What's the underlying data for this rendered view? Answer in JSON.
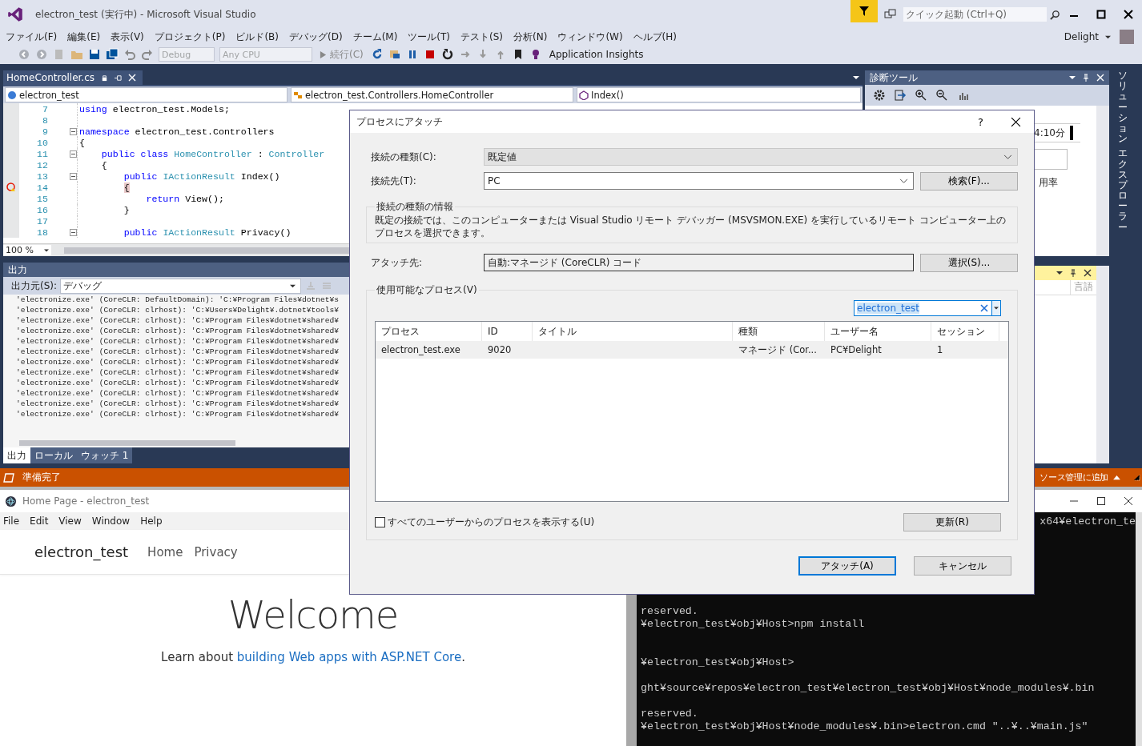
{
  "vs": {
    "title": "electron_test (実行中) - Microsoft Visual Studio",
    "quick_launch": {
      "placeholder": "クイック起動 (Ctrl+Q)"
    },
    "menu": [
      "ファイル(F)",
      "編集(E)",
      "表示(V)",
      "プロジェクト(P)",
      "ビルド(B)",
      "デバッグ(D)",
      "チーム(M)",
      "ツール(T)",
      "テスト(S)",
      "分析(N)",
      "ウィンドウ(W)",
      "ヘルプ(H)"
    ],
    "user": "Delight",
    "toolbar": {
      "configuration": {
        "label": "Debug",
        "disabled": true
      },
      "platform": {
        "label": "Any CPU",
        "disabled": true
      },
      "continue": "続行(C)",
      "insights": "Application Insights"
    },
    "editor": {
      "tab": "HomeController.cs",
      "project": "electron_test",
      "type": "electron_test.Controllers.HomeController",
      "member": "Index()",
      "zoom": "100 %",
      "lines": [
        {
          "number": "7",
          "fold": false,
          "breakpoint": false,
          "tokens": [
            {
              "kind": "keyword",
              "text": "using"
            },
            {
              "kind": "plain",
              "text": " electron_test.Models;"
            }
          ]
        },
        {
          "number": "8",
          "fold": false,
          "breakpoint": false
        },
        {
          "number": "9",
          "fold": true,
          "breakpoint": false,
          "tokens": [
            {
              "kind": "keyword",
              "text": "namespace"
            },
            {
              "kind": "plain",
              "text": " electron_test.Controllers"
            }
          ]
        },
        {
          "number": "10",
          "fold": false,
          "breakpoint": false,
          "tokens": [
            {
              "kind": "plain",
              "text": "{"
            }
          ]
        },
        {
          "number": "11",
          "fold": true,
          "breakpoint": false,
          "tokens": [
            {
              "kind": "keyword",
              "text": "    public class"
            },
            {
              "kind": "type",
              "text": " HomeController"
            },
            {
              "kind": "plain",
              "text": " : "
            },
            {
              "kind": "type",
              "text": "Controller"
            }
          ]
        },
        {
          "number": "12",
          "fold": false,
          "breakpoint": false,
          "tokens": [
            {
              "kind": "plain",
              "text": "    {"
            }
          ]
        },
        {
          "number": "13",
          "fold": true,
          "breakpoint": false,
          "tokens": [
            {
              "kind": "keyword",
              "text": "        public"
            },
            {
              "kind": "type",
              "text": " IActionResult"
            },
            {
              "kind": "plain",
              "text": " Index()"
            }
          ]
        },
        {
          "number": "14",
          "fold": false,
          "breakpoint": true,
          "tokens": [
            {
              "kind": "match",
              "text": "        {"
            }
          ]
        },
        {
          "number": "15",
          "fold": false,
          "breakpoint": false,
          "tokens": [
            {
              "kind": "keyword",
              "text": "            return"
            },
            {
              "kind": "plain",
              "text": " View();"
            }
          ]
        },
        {
          "number": "16",
          "fold": false,
          "breakpoint": false,
          "tokens": [
            {
              "kind": "plain",
              "text": "        }"
            }
          ]
        },
        {
          "number": "17",
          "fold": false,
          "breakpoint": false
        },
        {
          "number": "18",
          "fold": true,
          "breakpoint": false,
          "tokens": [
            {
              "kind": "keyword",
              "text": "        public"
            },
            {
              "kind": "type",
              "text": " IActionResult"
            },
            {
              "kind": "plain",
              "text": " Privacy()"
            }
          ]
        }
      ]
    },
    "output": {
      "title": "出力",
      "source_label": "出力元(S):",
      "source": "デバッグ",
      "lines": [
        "'electronize.exe' (CoreCLR: DefaultDomain): 'C:¥Program Files¥dotnet¥s",
        "'electronize.exe' (CoreCLR: clrhost): 'C:¥Users¥Delight¥.dotnet¥tools¥",
        "'electronize.exe' (CoreCLR: clrhost): 'C:¥Program Files¥dotnet¥shared¥",
        "'electronize.exe' (CoreCLR: clrhost): 'C:¥Program Files¥dotnet¥shared¥",
        "'electronize.exe' (CoreCLR: clrhost): 'C:¥Program Files¥dotnet¥shared¥",
        "'electronize.exe' (CoreCLR: clrhost): 'C:¥Program Files¥dotnet¥shared¥",
        "'electronize.exe' (CoreCLR: clrhost): 'C:¥Program Files¥dotnet¥shared¥",
        "'electronize.exe' (CoreCLR: clrhost): 'C:¥Program Files¥dotnet¥shared¥",
        "'electronize.exe' (CoreCLR: clrhost): 'C:¥Program Files¥dotnet¥shared¥",
        "'electronize.exe' (CoreCLR: clrhost): 'C:¥Program Files¥dotnet¥shared¥",
        "'electronize.exe' (CoreCLR: clrhost): 'C:¥Program Files¥dotnet¥shared¥",
        "'electronize.exe' (CoreCLR: clrhost): 'C:¥Program Files¥dotnet¥shared¥"
      ],
      "tabs": [
        {
          "label": "出力",
          "selected": true
        },
        {
          "label": "ローカル",
          "selected": false
        },
        {
          "label": "ウォッチ 1",
          "selected": false
        }
      ]
    },
    "diagnostics": {
      "title": "診断ツール",
      "time": "4:10分",
      "usage_label": "用率",
      "column": "言語"
    },
    "solution_explorer": [
      "ソリューション",
      "エクスプローラー"
    ],
    "status": {
      "text": "準備完了",
      "source_control": "ソース管理に追加"
    }
  },
  "dialog": {
    "title": "プロセスにアタッチ",
    "help": "?",
    "connection_type": {
      "label": "接続の種類(C):",
      "value": "既定値"
    },
    "target": {
      "label": "接続先(T):",
      "value": "PC",
      "button": "検索(F)..."
    },
    "info": {
      "title": "接続の種類の情報",
      "text": "既定の接続では、このコンピューターまたは Visual Studio リモート デバッガー (MSVSMON.EXE) を実行しているリモート コンピューター上のプロセスを選択できます。"
    },
    "attach_to": {
      "label": "アタッチ先:",
      "value": "自動:マネージド (CoreCLR) コード",
      "button": "選択(S)..."
    },
    "processes": {
      "title": "使用可能なプロセス(V)",
      "filter": "electron_test",
      "columns": [
        "プロセス",
        "ID",
        "タイトル",
        "種類",
        "ユーザー名",
        "セッション"
      ],
      "rows": [
        {
          "selected": true,
          "process": "electron_test.exe",
          "id": "9020",
          "type": "マネージド (Cor...",
          "user": "PC¥Delight",
          "session": "1"
        }
      ],
      "show_all": {
        "label": "すべてのユーザーからのプロセスを表示する(U)",
        "checked": false
      },
      "refresh": "更新(R)"
    },
    "buttons": [
      {
        "label": "アタッチ(A)",
        "default": true
      },
      {
        "label": "キャンセル",
        "default": false
      }
    ]
  },
  "electron": {
    "title": "Home Page - electron_test",
    "menu": [
      "File",
      "Edit",
      "View",
      "Window",
      "Help"
    ],
    "brand": "electron_test",
    "nav": [
      "Home",
      "Privacy"
    ],
    "heading": "Welcome",
    "lead": {
      "text": "Learn about ",
      "link": "building Web apps with ASP.NET Core",
      "after": "."
    }
  },
  "console": {
    "lines": [
      "x64¥electron_te",
      "reserved.",
      "¥electron_test¥obj¥Host>npm install",
      "¥electron_test¥obj¥Host>",
      "ght¥source¥repos¥electron_test¥electron_test¥obj¥Host¥node_modules¥.bin",
      "reserved.",
      "¥electron_test¥obj¥Host¥node_modules¥.bin>electron.cmd \"..¥..¥main.js\""
    ]
  }
}
